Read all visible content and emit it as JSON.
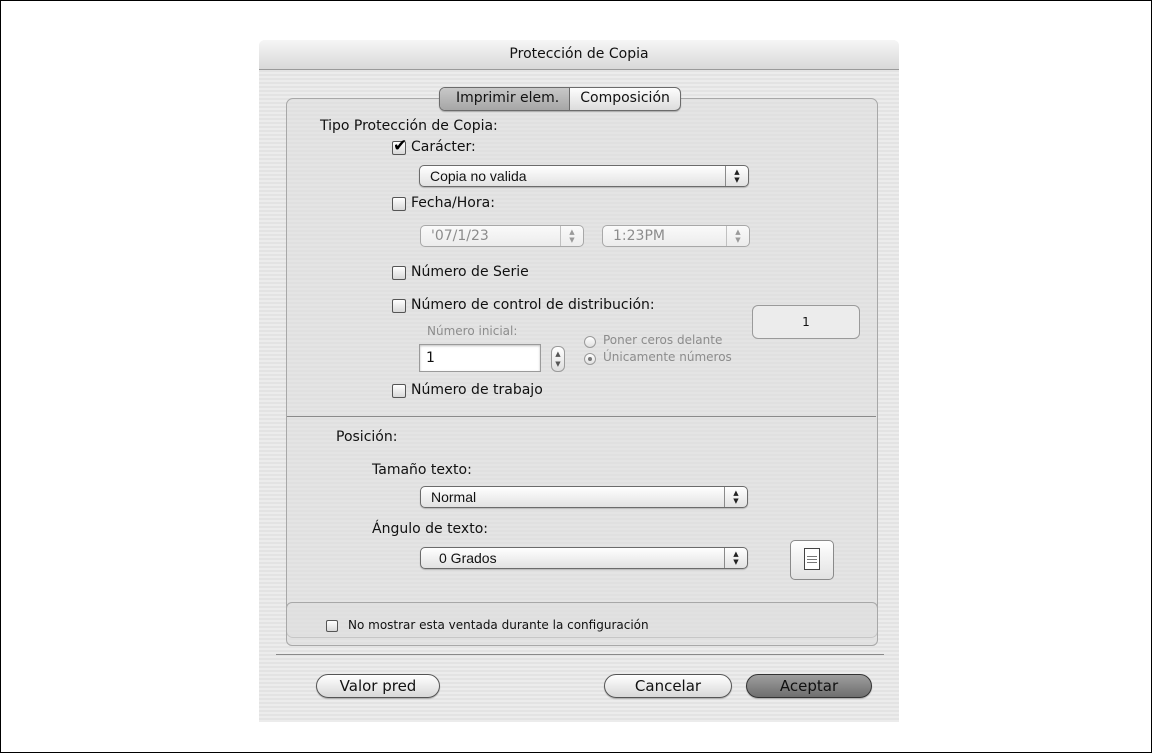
{
  "dialog": {
    "title": "Protección de Copia"
  },
  "tabs": [
    {
      "label": "Imprimir elem.",
      "selected": true
    },
    {
      "label": "Composición",
      "selected": false
    }
  ],
  "copy_protect": {
    "section_label": "Tipo Protección de Copia:",
    "character": {
      "label": "Carácter:",
      "checked": true,
      "checkmark": "✔",
      "value": "Copia no valida"
    },
    "datetime": {
      "label": "Fecha/Hora:",
      "checked": false,
      "date_value": "'07/1/23",
      "time_value": "1:23PM"
    },
    "serial": {
      "label": "Número de Serie",
      "checked": false
    },
    "distribution": {
      "label": "Número de control de distribución:",
      "checked": false,
      "count_value": "1",
      "start_label": "Número inicial:",
      "start_value": "1",
      "radio_leading_zeros": "Poner ceros delante",
      "radio_numbers_only": "Únicamente números",
      "selected_radio": "Únicamente números"
    },
    "job_number": {
      "label": "Número de trabajo",
      "checked": false
    }
  },
  "position": {
    "section_label": "Posición:",
    "text_size_label": "Tamaño texto:",
    "text_size_value": "Normal",
    "text_angle_label": "Ángulo de texto:",
    "text_angle_value": "0 Grados"
  },
  "footer": {
    "dont_show_label": "No mostrar esta ventada durante la configuración",
    "dont_show_checked": false,
    "default_button": "Valor pred",
    "cancel_button": "Cancelar",
    "ok_button": "Aceptar"
  },
  "icons": {
    "popup_arrows": "▲▼",
    "orientation": "page-orientation-icon"
  }
}
